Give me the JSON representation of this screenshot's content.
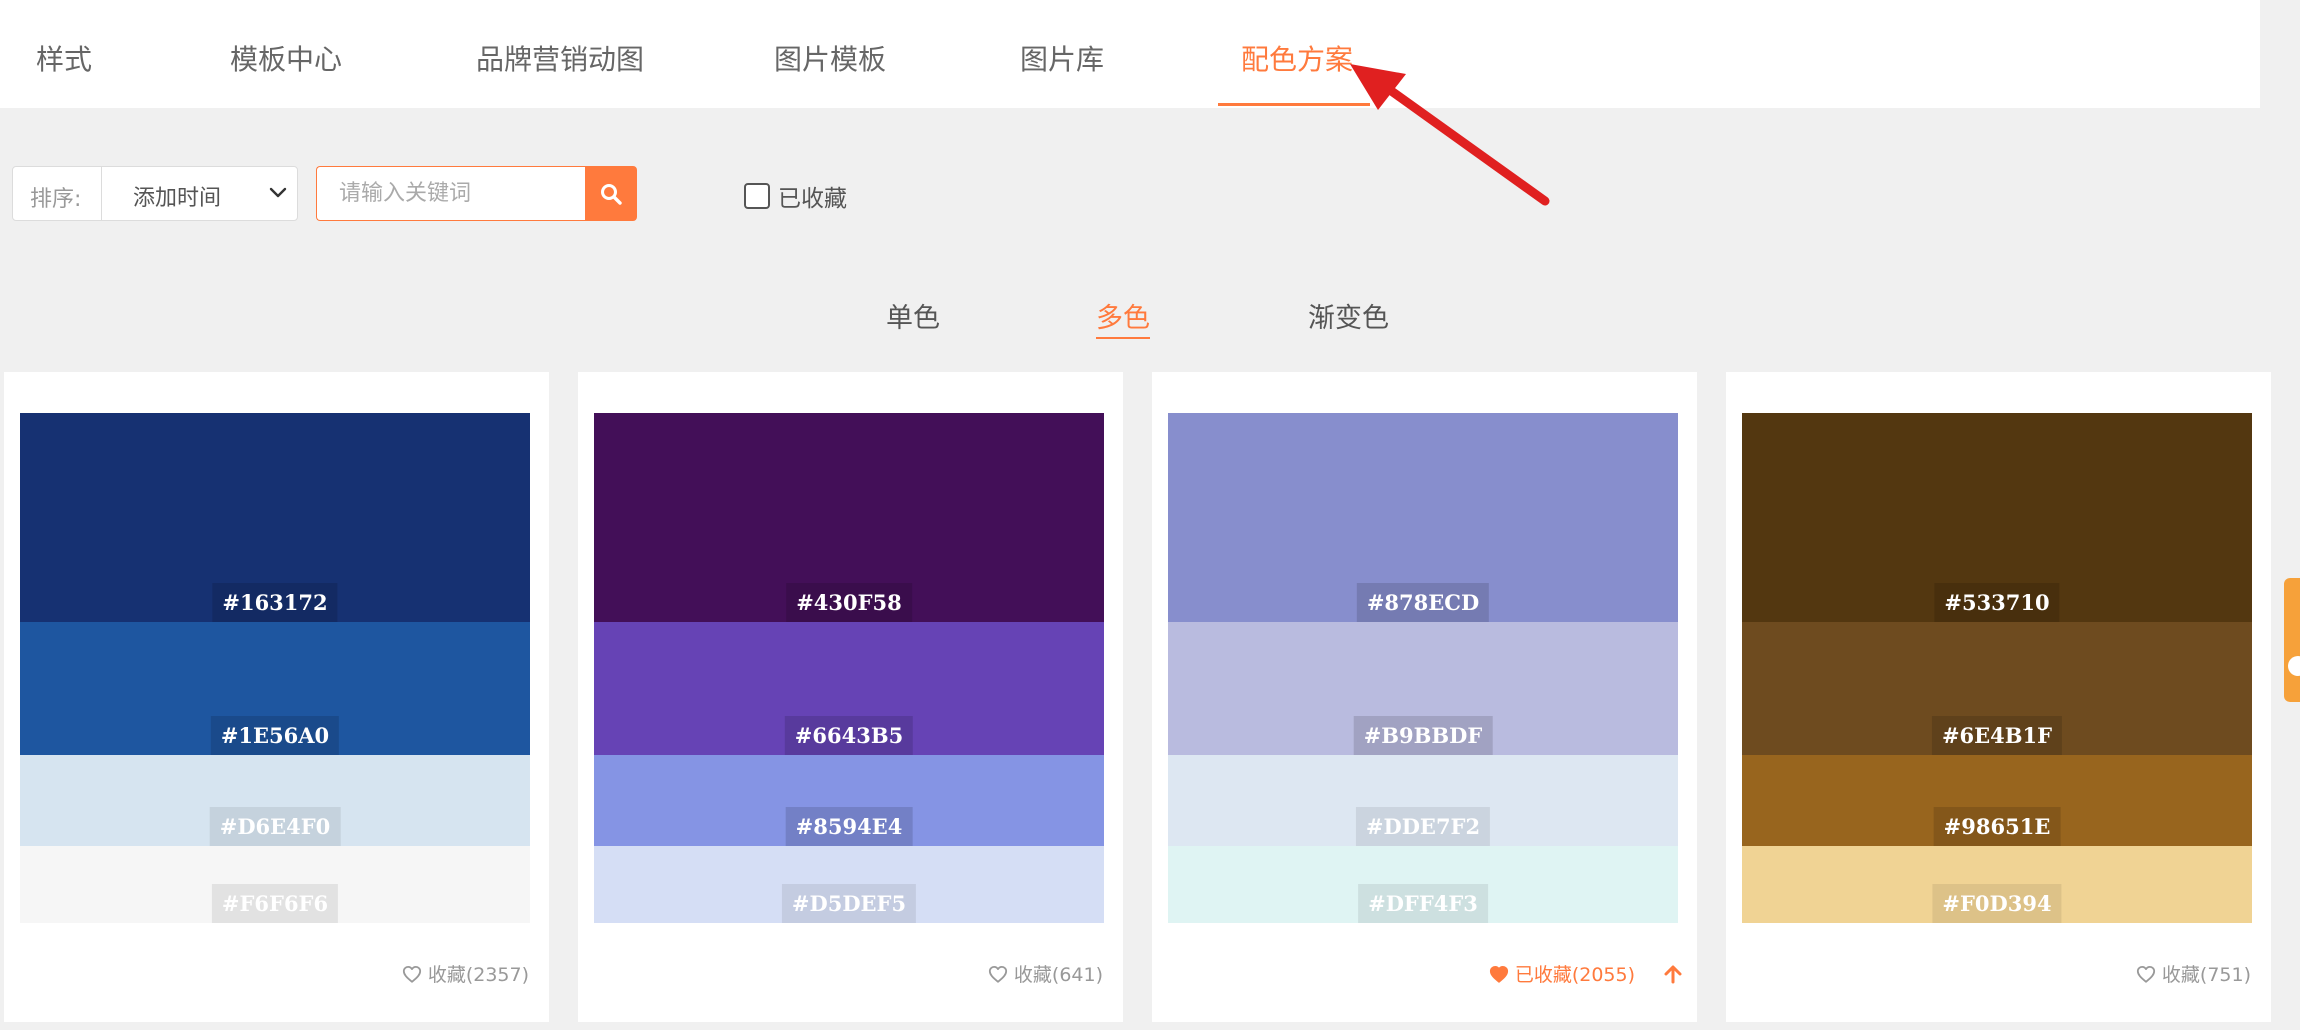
{
  "nav": {
    "items": [
      {
        "label": "样式",
        "active": false
      },
      {
        "label": "模板中心",
        "active": false
      },
      {
        "label": "品牌营销动图",
        "active": false
      },
      {
        "label": "图片模板",
        "active": false
      },
      {
        "label": "图片库",
        "active": false
      },
      {
        "label": "配色方案",
        "active": true
      }
    ]
  },
  "toolbar": {
    "sort_label": "排序:",
    "sort_value": "添加时间",
    "search_placeholder": "请输入关键词",
    "favorites_label": "已收藏"
  },
  "subtabs": [
    {
      "label": "单色",
      "active": false
    },
    {
      "label": "多色",
      "active": true
    },
    {
      "label": "渐变色",
      "active": false
    }
  ],
  "colors": {
    "accent": "#ff7a3d",
    "annotation_arrow": "#e02020"
  },
  "cards": [
    {
      "swatches": [
        "#163172",
        "#1E56A0",
        "#D6E4F0",
        "#F6F6F6"
      ],
      "fav_text": "收藏(2357)",
      "favorited": false
    },
    {
      "swatches": [
        "#430F58",
        "#6643B5",
        "#8594E4",
        "#D5DEF5"
      ],
      "fav_text": "收藏(641)",
      "favorited": false
    },
    {
      "swatches": [
        "#878ECD",
        "#B9BBDF",
        "#DDE7F2",
        "#DFF4F3"
      ],
      "fav_text": "已收藏(2055)",
      "favorited": true
    },
    {
      "swatches": [
        "#533710",
        "#6E4B1F",
        "#98651E",
        "#F0D394"
      ],
      "fav_text": "收藏(751)",
      "favorited": false
    }
  ]
}
